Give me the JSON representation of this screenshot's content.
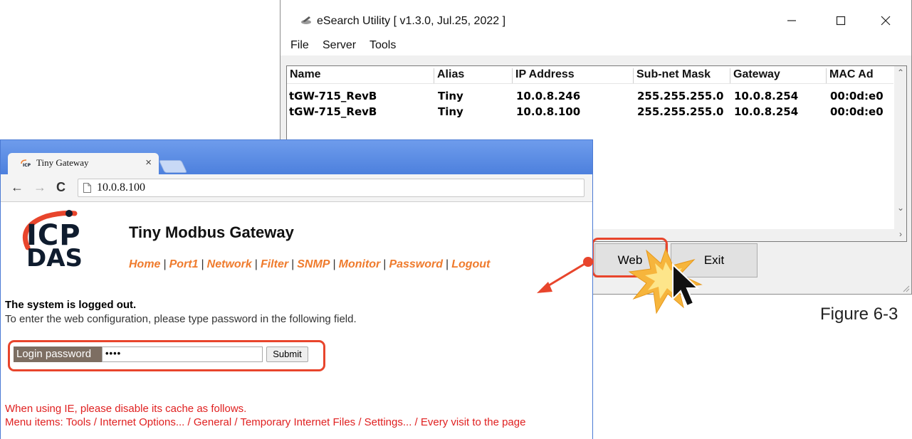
{
  "esearch": {
    "title": "eSearch Utility [ v1.3.0, Jul.25, 2022 ]",
    "menu": [
      {
        "label": "File"
      },
      {
        "label": "Server"
      },
      {
        "label": "Tools"
      }
    ],
    "columns": [
      "Name",
      "Alias",
      "IP Address",
      "Sub-net Mask",
      "Gateway",
      "MAC Ad"
    ],
    "rows": [
      {
        "name": "tGW-715_RevB",
        "alias": "Tiny",
        "ip": "10.0.8.246",
        "mask": "255.255.255.0",
        "gateway": "10.0.8.254",
        "mac": "00:0d:e0"
      },
      {
        "name": "tGW-715_RevB",
        "alias": "Tiny",
        "ip": "10.0.8.100",
        "mask": "255.255.255.0",
        "gateway": "10.0.8.254",
        "mac": "00:0d:e0"
      }
    ],
    "web_button": "Web",
    "exit_button": "Exit"
  },
  "browser": {
    "tab_title": "Tiny Gateway",
    "url": "10.0.8.100"
  },
  "page": {
    "logo_top": "ICP",
    "logo_bottom": "DAS",
    "title": "Tiny Modbus Gateway",
    "nav": [
      {
        "label": "Home"
      },
      {
        "label": "Port1"
      },
      {
        "label": "Network"
      },
      {
        "label": "Filter"
      },
      {
        "label": "SNMP"
      },
      {
        "label": "Monitor"
      },
      {
        "label": "Password"
      },
      {
        "label": "Logout"
      }
    ],
    "logout_message": "The system is logged out.",
    "instruction": "To enter the web configuration, please type password in the following field.",
    "password_label": "Login password",
    "password_value": "••••",
    "submit_label": "Submit",
    "ie_note_line1": "When using IE, please disable its cache as follows.",
    "ie_note_line2": "Menu items: Tools / Internet Options... / General / Temporary Internet Files / Settings... / Every visit to the page"
  },
  "figure_caption": "Figure 6-3",
  "colors": {
    "highlight": "#e8452c",
    "nav_link": "#ef7b2d",
    "note_text": "#e02020",
    "browser_frame": "#4d80dd"
  }
}
